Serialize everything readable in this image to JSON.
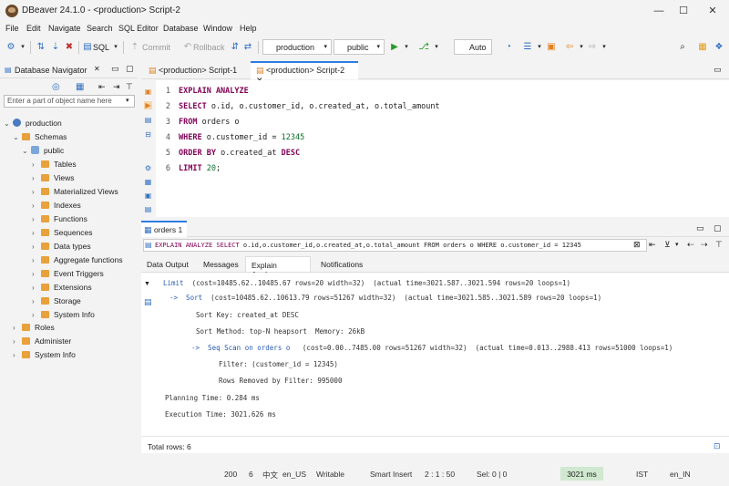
{
  "window": {
    "title": "DBeaver 24.1.0 - <production> Script-2",
    "minimize": "—",
    "maximize": "☐",
    "close": "✕"
  },
  "menu": [
    "File",
    "Edit",
    "Navigate",
    "Search",
    "SQL Editor",
    "Database",
    "Window",
    "Help"
  ],
  "toolbar": {
    "sql_label": "SQL",
    "commit_label": "Commit",
    "rollback_label": "Rollback",
    "datasource": "production",
    "schema": "public",
    "tx_mode": "Auto"
  },
  "navigator": {
    "title": "Database Navigator",
    "filter_placeholder": "Enter a part of object name here",
    "tree": [
      {
        "label": "production",
        "kind": "db",
        "arrow": "⌄"
      },
      {
        "label": "Schemas",
        "kind": "folder",
        "arrow": "⌄"
      },
      {
        "label": "public",
        "kind": "schema",
        "arrow": "⌄"
      },
      {
        "label": "Tables",
        "kind": "folder",
        "arrow": "›"
      },
      {
        "label": "Views",
        "kind": "folder",
        "arrow": "›"
      },
      {
        "label": "Materialized Views",
        "kind": "folder",
        "arrow": "›"
      },
      {
        "label": "Indexes",
        "kind": "folder",
        "arrow": "›"
      },
      {
        "label": "Functions",
        "kind": "folder",
        "arrow": "›"
      },
      {
        "label": "Sequences",
        "kind": "folder",
        "arrow": "›"
      },
      {
        "label": "Data types",
        "kind": "folder",
        "arrow": "›"
      },
      {
        "label": "Aggregate functions",
        "kind": "folder",
        "arrow": "›"
      },
      {
        "label": "Event Triggers",
        "kind": "folder",
        "arrow": "›"
      },
      {
        "label": "Extensions",
        "kind": "folder",
        "arrow": "›"
      },
      {
        "label": "Storage",
        "kind": "folder",
        "arrow": "›"
      },
      {
        "label": "System Info",
        "kind": "folder",
        "arrow": "›"
      },
      {
        "label": "Roles",
        "kind": "folder",
        "arrow": "›"
      },
      {
        "label": "Administer",
        "kind": "folder",
        "arrow": "›"
      },
      {
        "label": "System Info",
        "kind": "folder",
        "arrow": "›"
      }
    ]
  },
  "editor": {
    "tabs": [
      "<production> Script-1",
      "<production> Script-2"
    ],
    "tab_close": "✕",
    "lines": [
      {
        "n": "1",
        "parts": [
          [
            "kw",
            "EXPLAIN ANALYZE"
          ]
        ]
      },
      {
        "n": "2",
        "parts": [
          [
            "kw",
            "SELECT"
          ],
          [
            "t",
            " o.id, o.customer_id, o.created_at, o.total_amount"
          ]
        ]
      },
      {
        "n": "3",
        "parts": [
          [
            "kw",
            "FROM"
          ],
          [
            "t",
            " orders o"
          ]
        ]
      },
      {
        "n": "4",
        "parts": [
          [
            "kw",
            "WHERE"
          ],
          [
            "t",
            " o.customer_id = "
          ],
          [
            "num",
            "12345"
          ]
        ]
      },
      {
        "n": "5",
        "parts": [
          [
            "kw",
            "ORDER BY"
          ],
          [
            "t",
            " o.created_at "
          ],
          [
            "kw",
            "DESC"
          ]
        ]
      },
      {
        "n": "6",
        "parts": [
          [
            "kw",
            "LIMIT"
          ],
          [
            "t",
            " "
          ],
          [
            "num",
            "20"
          ],
          [
            "t",
            ";"
          ]
        ]
      }
    ]
  },
  "results": {
    "tab_label": "orders 1",
    "filter_prefix": "EXPLAIN ANALYZE  SELECT",
    "filter_rest": " o.id,o.customer_id,o.created_at,o.total_amount FROM orders o WHERE o.customer_id = 12345",
    "sub_tabs": [
      "Data Output",
      "Messages",
      "Explain Analyze",
      "Notifications"
    ],
    "active_sub_tab": "Explain Analyze",
    "plan": [
      {
        "indent": 0,
        "node": "Limit",
        "text": "  (cost=10485.62..10485.67 rows=20 width=32)  (actual time=3021.587..3021.594 rows=20 loops=1)"
      },
      {
        "indent": 1,
        "node": "->  Sort",
        "text": "  (cost=10485.62..10613.79 rows=51267 width=32)  (actual time=3021.585..3021.589 rows=20 loops=1)"
      },
      {
        "indent": 2,
        "node": "",
        "text": "Sort Key: created_at DESC"
      },
      {
        "indent": 2,
        "node": "",
        "text": "Sort Method: top-N heapsort  Memory: 26kB"
      },
      {
        "indent": 2,
        "node": "->  Seq Scan on orders o",
        "text": "   (cost=0.00..7485.00 rows=51267 width=32)  (actual time=0.013..2988.413 rows=51000 loops=1)"
      },
      {
        "indent": 3,
        "node": "",
        "text": "Filter: (customer_id = 12345)"
      },
      {
        "indent": 3,
        "node": "",
        "text": "Rows Removed by Filter: 995000"
      },
      {
        "indent": 0,
        "node": "",
        "text": "Planning Time: 0.284 ms"
      },
      {
        "indent": 0,
        "node": "",
        "text": "Execution Time: 3021.626 ms"
      }
    ],
    "total_rows": "Total rows: 6"
  },
  "status": {
    "num1": "200",
    "num2": "6",
    "ime": "中文",
    "locale": "en_US",
    "mode": "Writable",
    "insert": "Smart Insert",
    "pos": "2 : 1 : 50",
    "sel": "Sel: 0 | 0",
    "time": "3021 ms",
    "tz": "IST",
    "lang": "en_IN"
  }
}
